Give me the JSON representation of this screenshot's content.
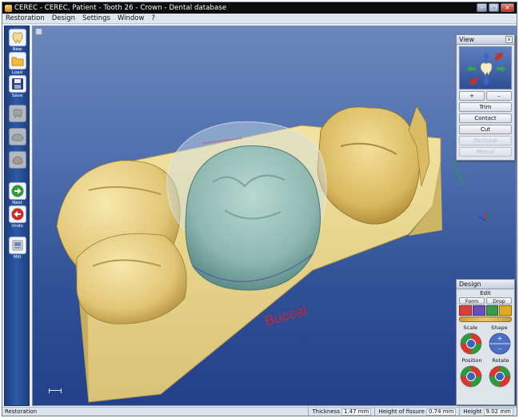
{
  "window": {
    "title": "CEREC - CEREC, Patient - Tooth 26 - Crown - Dental database",
    "minimize": "–",
    "maximize": "□",
    "close": "×"
  },
  "menu": [
    "Restoration",
    "Design",
    "Settings",
    "Window",
    "?"
  ],
  "toolbar": [
    {
      "label": "New",
      "icon": "new-icon",
      "enabled": true
    },
    {
      "label": "Load",
      "icon": "folder-icon",
      "enabled": true
    },
    {
      "label": "Save",
      "icon": "save-icon",
      "enabled": true
    },
    {
      "label": "",
      "icon": "tooth-step-icon",
      "enabled": false
    },
    {
      "label": "",
      "icon": "jaw-step-icon",
      "enabled": false
    },
    {
      "label": "",
      "icon": "model-step-icon",
      "enabled": false
    },
    {
      "label": "Next",
      "icon": "arrow-right-icon",
      "enabled": true
    },
    {
      "label": "Undo",
      "icon": "arrow-left-icon",
      "enabled": true
    },
    {
      "label": "Mill",
      "icon": "mill-icon",
      "enabled": true
    }
  ],
  "viewport": {
    "annotation": "Buccal"
  },
  "view_panel": {
    "title": "View",
    "zoom_in": "+",
    "zoom_out": "–",
    "buttons": [
      {
        "label": "Trim",
        "enabled": true
      },
      {
        "label": "Contact",
        "enabled": true
      },
      {
        "label": "Cut",
        "enabled": true
      },
      {
        "label": "Occlusal",
        "enabled": false
      },
      {
        "label": "Mesial",
        "enabled": false
      }
    ]
  },
  "design_panel": {
    "title": "Design",
    "tool_label": "Edit",
    "tabs": [
      "Form",
      "Drop"
    ],
    "sections": [
      "Scale",
      "Shape",
      "Position",
      "Rotate"
    ],
    "shape_plus": "+",
    "shape_minus": "–"
  },
  "status": {
    "mode": "Restoration",
    "thickness_label": "Thickness",
    "thickness": "1.47 mm",
    "fissure_label": "Height of fissure",
    "fissure": "0.74 mm",
    "height_label": "Height",
    "height": "9.02 mm"
  },
  "colors": {
    "viewport_top": "#6b86ba",
    "viewport_bottom": "#23408a",
    "toolbar": "#2c5aa8",
    "model": "#e9d68c",
    "crown": "#9cc3bd"
  }
}
